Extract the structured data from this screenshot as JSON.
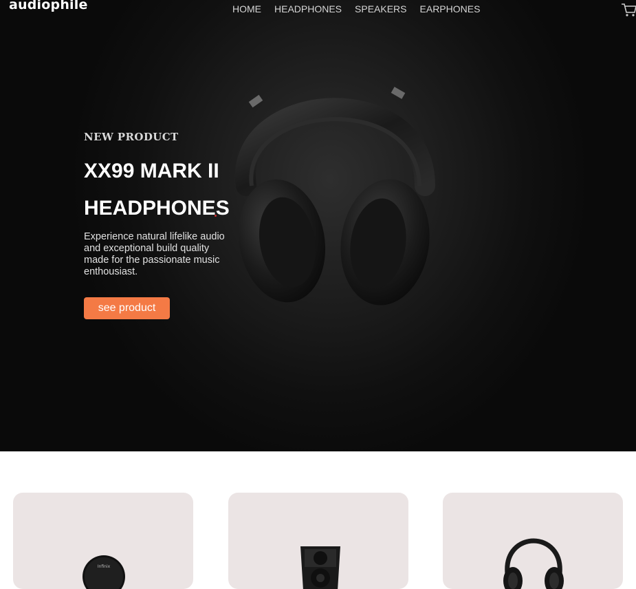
{
  "header": {
    "logo": "audiophile",
    "nav": [
      "HOME",
      "HEADPHONES",
      "SPEAKERS",
      "EARPHONES"
    ],
    "cart_icon": "cart-icon"
  },
  "hero": {
    "eyebrow": "NEW PRODUCT",
    "title": "XX99 MARK II HEADPHONES",
    "description": "Experience natural lifelike audio and exceptional build quality made for the passionate music enthousiast.",
    "cta_label": "see product",
    "accent_color": "#f47a45"
  },
  "categories": {
    "cards": [
      {
        "image": "portable-speaker-image",
        "brand_text": "Infinix"
      },
      {
        "image": "floor-speaker-image"
      },
      {
        "image": "headphones-image"
      }
    ]
  }
}
